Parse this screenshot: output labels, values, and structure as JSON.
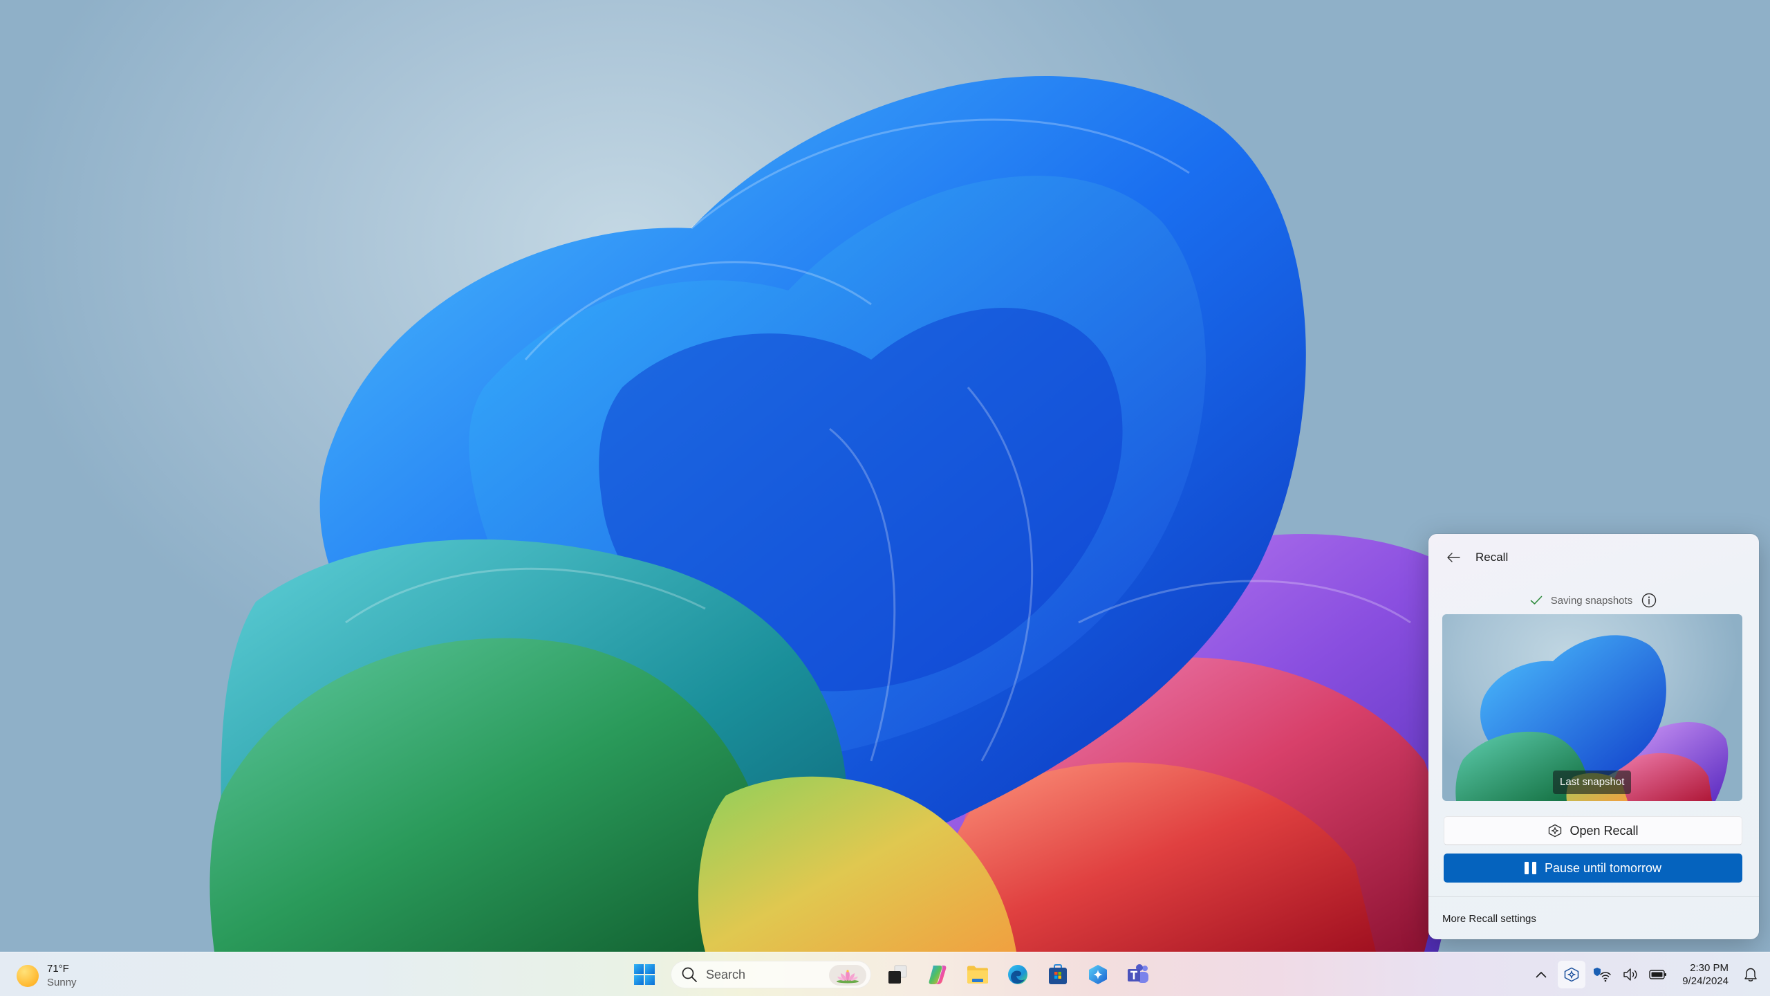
{
  "desktop": {
    "wallpaper": "Windows 11 colorful bloom",
    "colors": {
      "sky_light": "#c4d8e4",
      "sky_dark": "#8fb0c8"
    }
  },
  "taskbar": {
    "weather": {
      "temperature": "71°F",
      "condition": "Sunny",
      "icon": "sun-icon"
    },
    "start": {
      "icon": "windows-logo-icon"
    },
    "search": {
      "placeholder": "Search",
      "icon": "search-icon",
      "highlight_icon": "lotus-icon"
    },
    "pinned_apps": [
      {
        "name": "Task View",
        "icon": "task-view-icon"
      },
      {
        "name": "Copilot",
        "icon": "copilot-icon"
      },
      {
        "name": "File Explorer",
        "icon": "folder-icon"
      },
      {
        "name": "Microsoft Edge",
        "icon": "edge-icon"
      },
      {
        "name": "Microsoft Store",
        "icon": "store-icon"
      },
      {
        "name": "Recall",
        "icon": "recall-icon"
      },
      {
        "name": "Microsoft Teams",
        "icon": "teams-icon"
      }
    ],
    "tray": {
      "overflow_icon": "chevron-up-icon",
      "recall_icon": "recall-icon",
      "system_icons": [
        "vpn-wifi-icon",
        "volume-icon",
        "battery-icon"
      ],
      "time": "2:30 PM",
      "date": "9/24/2024",
      "notifications_icon": "bell-icon"
    }
  },
  "recall_flyout": {
    "title": "Recall",
    "back_icon": "arrow-left-icon",
    "status": {
      "text": "Saving snapshots",
      "icon": "checkmark-icon",
      "info_icon": "info-icon",
      "color": "#2e8b3c"
    },
    "thumbnail": {
      "label": "Last snapshot"
    },
    "open_button": {
      "label": "Open Recall",
      "icon": "recall-icon"
    },
    "pause_button": {
      "label": "Pause until tomorrow",
      "icon": "pause-icon",
      "color": "#0563be"
    },
    "footer_link": "More Recall settings"
  }
}
